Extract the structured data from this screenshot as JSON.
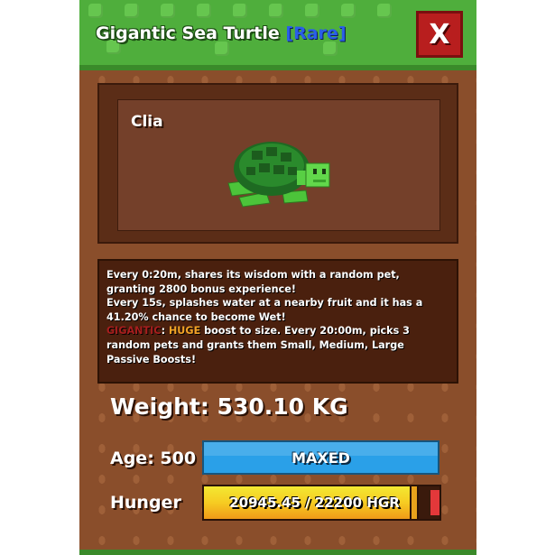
{
  "header": {
    "title": "Gigantic Sea Turtle",
    "rarity": "[Rare]",
    "close_label": "X"
  },
  "pet": {
    "name": "Clia"
  },
  "description": {
    "line1": "Every 0:20m, shares its wisdom with a random pet, granting 2800 bonus experience!",
    "line2": "Every 15s, splashes water at a nearby fruit and it has a 41.20% chance to become Wet!",
    "mutation_keyword": "GIGANTIC",
    "mutation_sep": ": ",
    "mutation_size": "HUGE",
    "mutation_rest": " boost to size. Every 20:00m, picks 3 random pets and grants them Small, Medium, Large Passive Boosts!"
  },
  "stats": {
    "weight_label": "Weight: 530.10 KG",
    "age_label": "Age: 500",
    "age_status": "MAXED",
    "hunger_label": "Hunger",
    "hunger_text": "20945.45 / 22200 HGR",
    "hunger_current": 20945.45,
    "hunger_max": 22200
  },
  "colors": {
    "rarity": "#2a5ee8",
    "mutation_keyword": "#a81e1e",
    "size_keyword": "#f2a326",
    "age_bar": "#2aa0e8",
    "hunger_fill": "#f6cc22",
    "close_button": "#b81e1e"
  },
  "icons": {
    "close": "close-icon",
    "pet_model": "sea-turtle-icon"
  }
}
